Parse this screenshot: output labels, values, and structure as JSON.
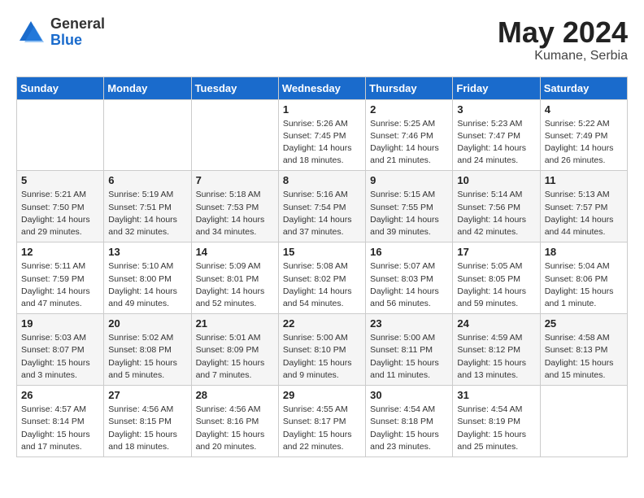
{
  "logo": {
    "general": "General",
    "blue": "Blue"
  },
  "title": {
    "month": "May 2024",
    "location": "Kumane, Serbia"
  },
  "weekdays": [
    "Sunday",
    "Monday",
    "Tuesday",
    "Wednesday",
    "Thursday",
    "Friday",
    "Saturday"
  ],
  "weeks": [
    [
      null,
      null,
      null,
      {
        "day": 1,
        "sunrise": "5:26 AM",
        "sunset": "7:45 PM",
        "daylight": "14 hours and 18 minutes."
      },
      {
        "day": 2,
        "sunrise": "5:25 AM",
        "sunset": "7:46 PM",
        "daylight": "14 hours and 21 minutes."
      },
      {
        "day": 3,
        "sunrise": "5:23 AM",
        "sunset": "7:47 PM",
        "daylight": "14 hours and 24 minutes."
      },
      {
        "day": 4,
        "sunrise": "5:22 AM",
        "sunset": "7:49 PM",
        "daylight": "14 hours and 26 minutes."
      }
    ],
    [
      {
        "day": 5,
        "sunrise": "5:21 AM",
        "sunset": "7:50 PM",
        "daylight": "14 hours and 29 minutes."
      },
      {
        "day": 6,
        "sunrise": "5:19 AM",
        "sunset": "7:51 PM",
        "daylight": "14 hours and 32 minutes."
      },
      {
        "day": 7,
        "sunrise": "5:18 AM",
        "sunset": "7:53 PM",
        "daylight": "14 hours and 34 minutes."
      },
      {
        "day": 8,
        "sunrise": "5:16 AM",
        "sunset": "7:54 PM",
        "daylight": "14 hours and 37 minutes."
      },
      {
        "day": 9,
        "sunrise": "5:15 AM",
        "sunset": "7:55 PM",
        "daylight": "14 hours and 39 minutes."
      },
      {
        "day": 10,
        "sunrise": "5:14 AM",
        "sunset": "7:56 PM",
        "daylight": "14 hours and 42 minutes."
      },
      {
        "day": 11,
        "sunrise": "5:13 AM",
        "sunset": "7:57 PM",
        "daylight": "14 hours and 44 minutes."
      }
    ],
    [
      {
        "day": 12,
        "sunrise": "5:11 AM",
        "sunset": "7:59 PM",
        "daylight": "14 hours and 47 minutes."
      },
      {
        "day": 13,
        "sunrise": "5:10 AM",
        "sunset": "8:00 PM",
        "daylight": "14 hours and 49 minutes."
      },
      {
        "day": 14,
        "sunrise": "5:09 AM",
        "sunset": "8:01 PM",
        "daylight": "14 hours and 52 minutes."
      },
      {
        "day": 15,
        "sunrise": "5:08 AM",
        "sunset": "8:02 PM",
        "daylight": "14 hours and 54 minutes."
      },
      {
        "day": 16,
        "sunrise": "5:07 AM",
        "sunset": "8:03 PM",
        "daylight": "14 hours and 56 minutes."
      },
      {
        "day": 17,
        "sunrise": "5:05 AM",
        "sunset": "8:05 PM",
        "daylight": "14 hours and 59 minutes."
      },
      {
        "day": 18,
        "sunrise": "5:04 AM",
        "sunset": "8:06 PM",
        "daylight": "15 hours and 1 minute."
      }
    ],
    [
      {
        "day": 19,
        "sunrise": "5:03 AM",
        "sunset": "8:07 PM",
        "daylight": "15 hours and 3 minutes."
      },
      {
        "day": 20,
        "sunrise": "5:02 AM",
        "sunset": "8:08 PM",
        "daylight": "15 hours and 5 minutes."
      },
      {
        "day": 21,
        "sunrise": "5:01 AM",
        "sunset": "8:09 PM",
        "daylight": "15 hours and 7 minutes."
      },
      {
        "day": 22,
        "sunrise": "5:00 AM",
        "sunset": "8:10 PM",
        "daylight": "15 hours and 9 minutes."
      },
      {
        "day": 23,
        "sunrise": "5:00 AM",
        "sunset": "8:11 PM",
        "daylight": "15 hours and 11 minutes."
      },
      {
        "day": 24,
        "sunrise": "4:59 AM",
        "sunset": "8:12 PM",
        "daylight": "15 hours and 13 minutes."
      },
      {
        "day": 25,
        "sunrise": "4:58 AM",
        "sunset": "8:13 PM",
        "daylight": "15 hours and 15 minutes."
      }
    ],
    [
      {
        "day": 26,
        "sunrise": "4:57 AM",
        "sunset": "8:14 PM",
        "daylight": "15 hours and 17 minutes."
      },
      {
        "day": 27,
        "sunrise": "4:56 AM",
        "sunset": "8:15 PM",
        "daylight": "15 hours and 18 minutes."
      },
      {
        "day": 28,
        "sunrise": "4:56 AM",
        "sunset": "8:16 PM",
        "daylight": "15 hours and 20 minutes."
      },
      {
        "day": 29,
        "sunrise": "4:55 AM",
        "sunset": "8:17 PM",
        "daylight": "15 hours and 22 minutes."
      },
      {
        "day": 30,
        "sunrise": "4:54 AM",
        "sunset": "8:18 PM",
        "daylight": "15 hours and 23 minutes."
      },
      {
        "day": 31,
        "sunrise": "4:54 AM",
        "sunset": "8:19 PM",
        "daylight": "15 hours and 25 minutes."
      },
      null
    ]
  ]
}
